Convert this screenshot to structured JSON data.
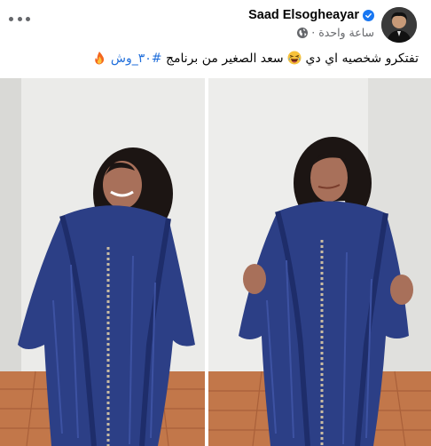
{
  "post": {
    "author": "Saad Elsogheayar",
    "time": "ساعة واحدة",
    "time_separator": "·",
    "caption_text": "تفتكرو شخصيه اي دي",
    "caption_mid": "سعد الصغير من برنامج",
    "hashtag": "#٣٠_وش"
  },
  "icons": {
    "verified": "verified-badge-icon",
    "privacy": "globe-icon",
    "more": "more-options-icon",
    "laugh": "laughing-emoji-icon",
    "fire": "fire-emoji-icon"
  },
  "colors": {
    "link": "#216fdb",
    "meta": "#65676b",
    "verified": "#1877f2",
    "robe": "#2c3f86"
  }
}
